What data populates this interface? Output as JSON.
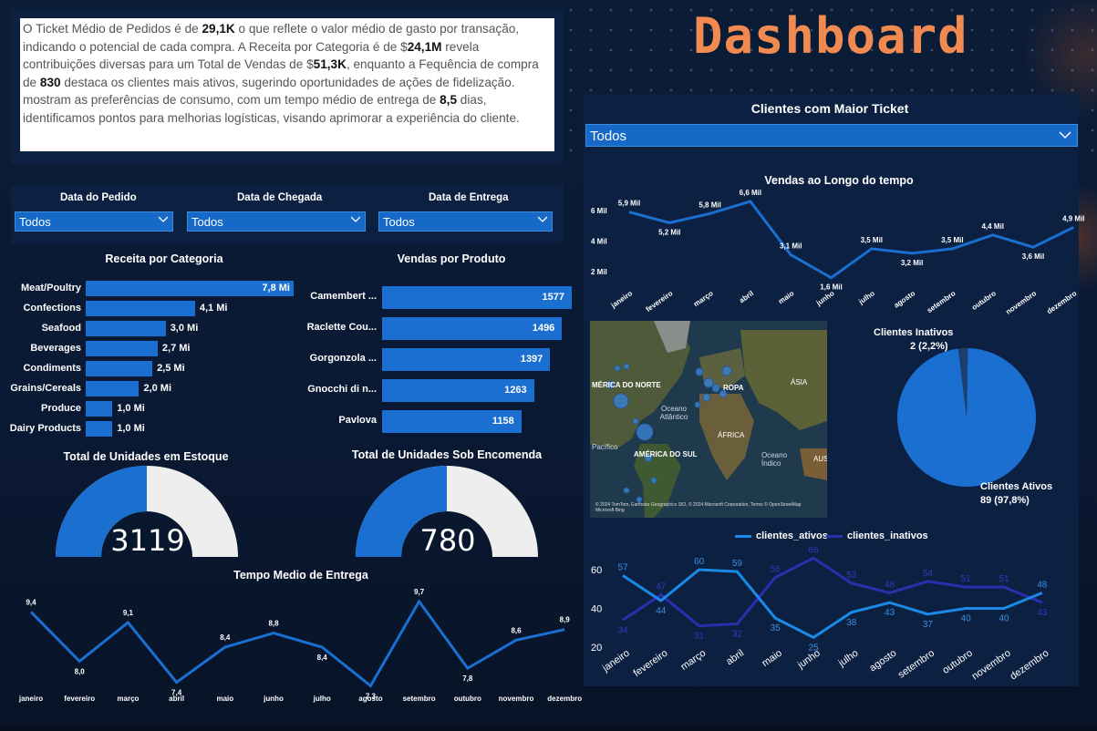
{
  "header": {
    "title": "Dashboard"
  },
  "summary": {
    "p1": "O Ticket Médio de Pedidos é de ",
    "v1": "29,1K",
    "p2": " o que reflete o valor médio de gasto por transação, indicando o potencial de cada compra. A Receita por Categoria é de $",
    "v2": "24,1M",
    "p3": " revela contribuições diversas para um Total de Vendas de $",
    "v3": "51,3K",
    "p4": ", enquanto a Fequência de compra de ",
    "v4": "830",
    "p5": " destaca os clientes mais ativos, sugerindo oportunidades de ações de fidelização. mostram as preferências de consumo, com um tempo médio de entrega de ",
    "v5": "8,5",
    "p6": " dias, identificamos pontos para melhorias logísticas, visando aprimorar a experiência do cliente."
  },
  "filters": [
    {
      "label": "Data do Pedido",
      "value": "Todos"
    },
    {
      "label": "Data de Chegada",
      "value": "Todos"
    },
    {
      "label": "Data de Entrega",
      "value": "Todos"
    }
  ],
  "receita": {
    "title": "Receita por Categoria",
    "items": [
      {
        "label": "Meat/Poultry",
        "value": 7.8,
        "display": "7,8 Mi"
      },
      {
        "label": "Confections",
        "value": 4.1,
        "display": "4,1 Mi"
      },
      {
        "label": "Seafood",
        "value": 3.0,
        "display": "3,0 Mi"
      },
      {
        "label": "Beverages",
        "value": 2.7,
        "display": "2,7 Mi"
      },
      {
        "label": "Condiments",
        "value": 2.5,
        "display": "2,5 Mi"
      },
      {
        "label": "Grains/Cereals",
        "value": 2.0,
        "display": "2,0 Mi"
      },
      {
        "label": "Produce",
        "value": 1.0,
        "display": "1,0 Mi"
      },
      {
        "label": "Dairy Products",
        "value": 1.0,
        "display": "1,0 Mi"
      }
    ]
  },
  "vendas_produto": {
    "title": "Vendas por Produto",
    "items": [
      {
        "label": "Camembert ...",
        "value": 1577
      },
      {
        "label": "Raclette Cou...",
        "value": 1496
      },
      {
        "label": "Gorgonzola ...",
        "value": 1397
      },
      {
        "label": "Gnocchi di n...",
        "value": 1263
      },
      {
        "label": "Pavlova",
        "value": 1158
      }
    ]
  },
  "estoque": {
    "title": "Total de Unidades em Estoque",
    "value": "3119",
    "fill": 0.5
  },
  "encomenda": {
    "title": "Total de Unidades Sob Encomenda",
    "value": "780",
    "fill": 0.5
  },
  "entrega": {
    "title": "Tempo Medio de Entrega",
    "months": [
      "janeiro",
      "fevereiro",
      "março",
      "abril",
      "maio",
      "junho",
      "julho",
      "agosto",
      "setembro",
      "outubro",
      "novembro",
      "dezembro"
    ],
    "values": [
      9.4,
      8.0,
      9.1,
      7.4,
      8.4,
      8.8,
      8.4,
      7.3,
      9.7,
      7.8,
      8.6,
      8.9
    ],
    "labels": [
      "9,4",
      "8,0",
      "9,1",
      "7,4",
      "8,4",
      "8,8",
      "8,4",
      "7,3",
      "9,7",
      "7,8",
      "8,6",
      "8,9"
    ]
  },
  "clientes": {
    "title": "Clientes com Maior Ticket",
    "dropdown": "Todos"
  },
  "vendas_tempo": {
    "title": "Vendas ao Longo do tempo",
    "y_ticks": [
      "6 Mil",
      "4 Mil",
      "2 Mil"
    ],
    "months": [
      "janeiro",
      "fevereiro",
      "março",
      "abril",
      "maio",
      "junho",
      "julho",
      "agosto",
      "setembro",
      "outubro",
      "novembro",
      "dezembro"
    ],
    "values": [
      5.9,
      5.2,
      5.8,
      6.6,
      3.1,
      1.6,
      3.5,
      3.2,
      3.5,
      4.4,
      3.6,
      4.9
    ],
    "labels": [
      "5,9 Mil",
      "5,2 Mil",
      "5,8 Mil",
      "6,6 Mil",
      "3,1 Mil",
      "1,6 Mil",
      "3,5 Mil",
      "3,2 Mil",
      "3,5 Mil",
      "4,4 Mil",
      "3,6 Mil",
      "4,9 Mil"
    ]
  },
  "map": {
    "labels": [
      "MÉRICA DO NORTE",
      "Oceano Atlântico",
      "ROPA",
      "ÁSIA",
      "ÁFRICA",
      "Pacífico",
      "AMÉRICA DO SUL",
      "Oceano Índico",
      "AUS"
    ],
    "credit": "© 2024 TomTom, Earthstar Geographics SIO, © 2024 Microsoft Corporation, Terms © OpenStreetMap",
    "brand": "Microsoft Bing"
  },
  "pizza": {
    "inativos_label": "Clientes Inativos",
    "inativos_value": "2 (2,2%)",
    "ativos_label": "Clientes Ativos",
    "ativos_value": "89 (97,8%)",
    "inativos_pct": 2.2,
    "ativos_pct": 97.8
  },
  "clientes_linhas": {
    "legend": [
      "clientes_ativos",
      "clientes_inativos"
    ],
    "y_ticks": [
      "60",
      "40",
      "20"
    ],
    "months": [
      "janeiro",
      "fevereiro",
      "março",
      "abril",
      "maio",
      "junho",
      "julho",
      "agosto",
      "setembro",
      "outubro",
      "novembro",
      "dezembro"
    ],
    "ativos": [
      57,
      44,
      60,
      59,
      35,
      25,
      38,
      43,
      37,
      40,
      40,
      48
    ],
    "inativos": [
      34,
      47,
      31,
      32,
      56,
      66,
      53,
      48,
      54,
      51,
      51,
      43
    ]
  },
  "colors": {
    "accent": "#1a6fd0",
    "title": "#f08a50",
    "dark_line": "#2a2fb0"
  }
}
